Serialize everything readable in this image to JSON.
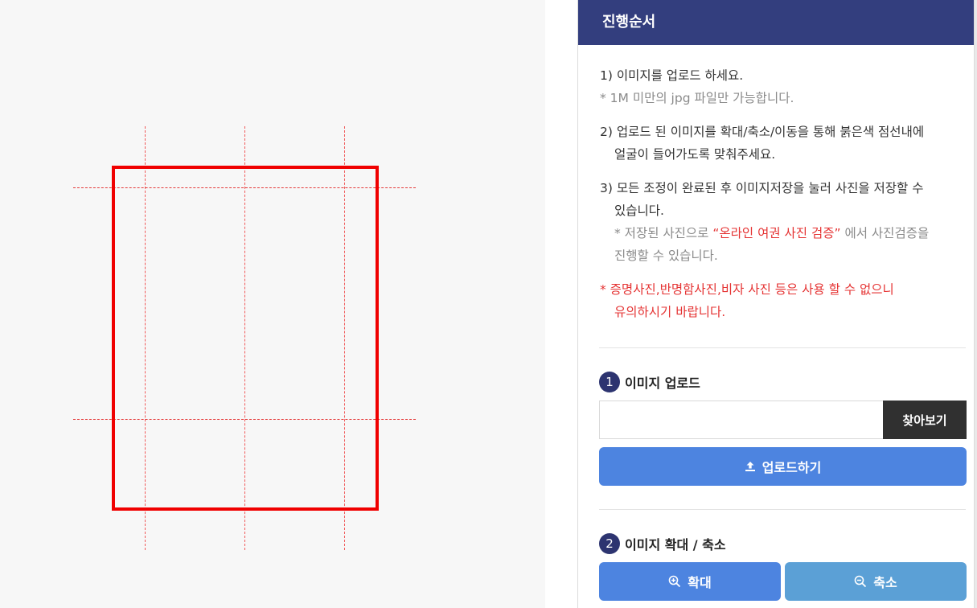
{
  "panel": {
    "header_title": "진행순서",
    "steps": {
      "s1_line1": "1) 이미지를 업로드 하세요.",
      "s1_note": "* 1M 미만의 jpg 파일만 가능합니다.",
      "s2_line1": "2) 업로드 된 이미지를 확대/축소/이동을 통해 붉은색 점선내에",
      "s2_line2": "얼굴이 들어가도록 맞춰주세요.",
      "s3_line1": "3) 모든 조정이 완료된 후 이미지저장을 눌러 사진을 저장할 수",
      "s3_line2": "있습니다.",
      "s3_note_prefix": "* 저장된 사진으로 ",
      "s3_note_link": "“온라인 여권 사진 검증”",
      "s3_note_suffix": " 에서 사진검증을",
      "s3_note_line2": "진행할 수 있습니다.",
      "warning_line1": "* 증명사진,반명함사진,비자 사진 등은 사용 할 수 없으니",
      "warning_line2": "유의하시기 바랍니다."
    },
    "upload_section": {
      "number": "1",
      "title": "이미지 업로드",
      "file_input_value": "",
      "browse_label": "찾아보기",
      "upload_label": "업로드하기"
    },
    "zoom_section": {
      "number": "2",
      "title": "이미지 확대 / 축소",
      "zoom_in_label": "확대",
      "zoom_out_label": "축소"
    }
  },
  "colors": {
    "header_bg": "#333e7e",
    "frame_red": "#f00000",
    "primary_blue": "#4d84e0",
    "secondary_blue": "#5ba0d6",
    "dark_button": "#303030",
    "warning_red": "#e53333"
  },
  "icons": {
    "upload": "upload-icon",
    "zoom_in": "zoom-in-icon",
    "zoom_out": "zoom-out-icon"
  }
}
